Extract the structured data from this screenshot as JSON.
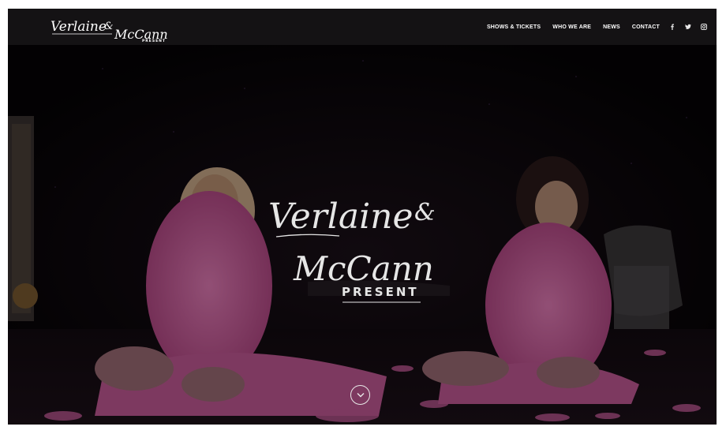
{
  "brand": {
    "name_line1": "Verlaine",
    "ampersand": "&",
    "name_line2": "McCann",
    "tagline": "PRESENT"
  },
  "nav": {
    "items": [
      {
        "label": "SHOWS & TICKETS"
      },
      {
        "label": "WHO WE ARE"
      },
      {
        "label": "NEWS"
      },
      {
        "label": "CONTACT"
      }
    ],
    "social": [
      {
        "icon": "facebook-icon",
        "glyph": "f"
      },
      {
        "icon": "twitter-icon",
        "glyph": "t"
      },
      {
        "icon": "instagram-icon",
        "glyph": "◎"
      }
    ]
  },
  "hero": {
    "title_line1": "Verlaine",
    "ampersand": "&",
    "title_line2": "McCann",
    "tagline": "PRESENT",
    "scroll_icon": "chevron-down-icon"
  },
  "colors": {
    "nav_bg": "#141214",
    "hero_bg": "#050305",
    "feather_pink": "#d65aa0",
    "text_light": "#e8e8e8"
  }
}
